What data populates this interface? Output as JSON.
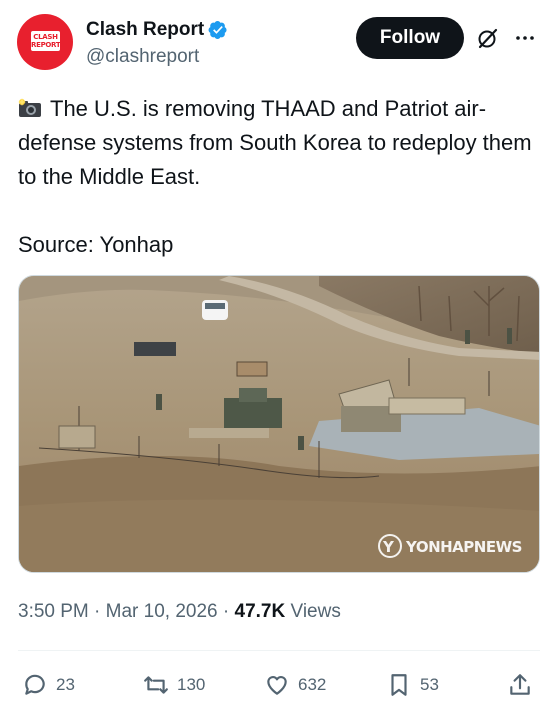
{
  "author": {
    "display_name": "Clash Report",
    "handle": "@clashreport",
    "avatar_text_line1": "CLASH",
    "avatar_text_line2": "REPORT",
    "verified": true
  },
  "header": {
    "follow_label": "Follow"
  },
  "tweet": {
    "text": "The U.S. is removing THAAD and Patriot air-defense systems from South Korea to redeploy them to the Middle East.\n\nSource: Yonhap",
    "leading_emoji": "camera-with-flash"
  },
  "media": {
    "watermark": "YONHAPNEWS"
  },
  "meta": {
    "time": "3:50 PM",
    "separator": "·",
    "date": "Mar 10, 2026",
    "views_count": "47.7K",
    "views_label": "Views"
  },
  "actions": {
    "replies": "23",
    "reposts": "130",
    "likes": "632",
    "bookmarks": "53"
  },
  "colors": {
    "text_primary": "#0f1419",
    "text_secondary": "#536471",
    "verified_blue": "#1d9bf0",
    "avatar_red": "#e8202e"
  }
}
